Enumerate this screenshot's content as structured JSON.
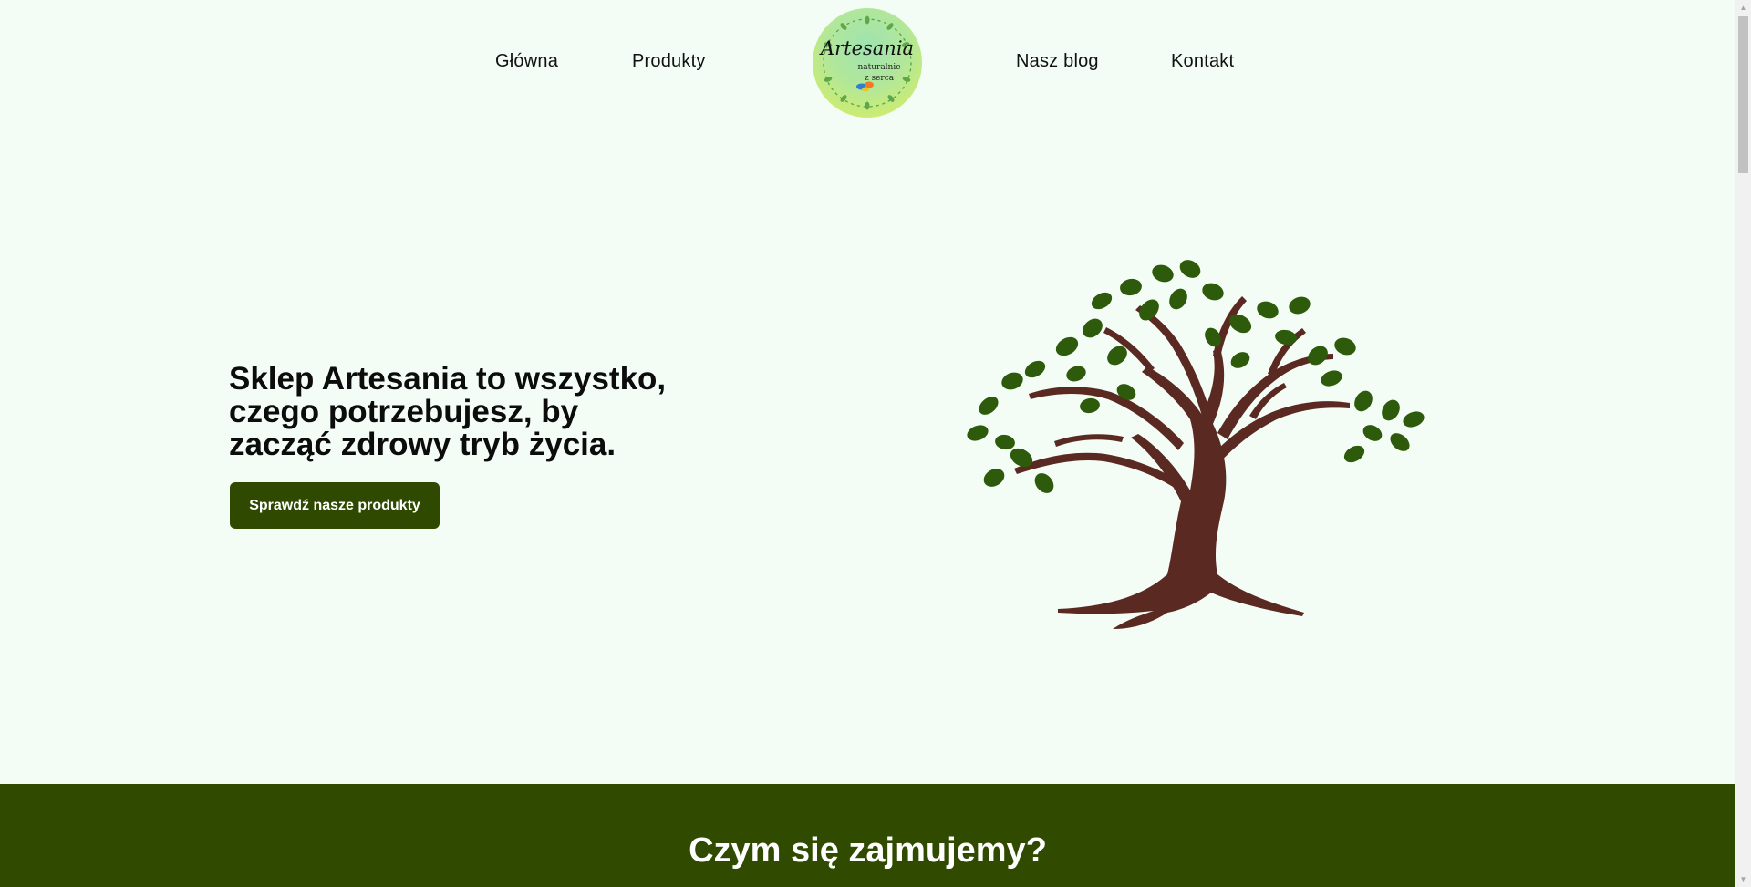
{
  "nav": {
    "left": [
      "Główna",
      "Produkty"
    ],
    "right": [
      "Nasz blog",
      "Kontakt"
    ]
  },
  "logo": {
    "brand": "Artesania",
    "tagline_1": "naturalnie",
    "tagline_2": "z serca"
  },
  "hero": {
    "title_lines": [
      "Sklep Artesania to wszystko,",
      "czego potrzebujesz, by",
      "zacząć zdrowy tryb życia."
    ],
    "cta_label": "Sprawdź nasze produkty",
    "illustration_icon": "tree-icon"
  },
  "section": {
    "title": "Czym się zajmujemy?"
  },
  "colors": {
    "background": "#f3fdf5",
    "brand_green": "#2f4a00",
    "leaf_green": "#2e5a0c",
    "trunk_brown": "#5a2a22"
  }
}
